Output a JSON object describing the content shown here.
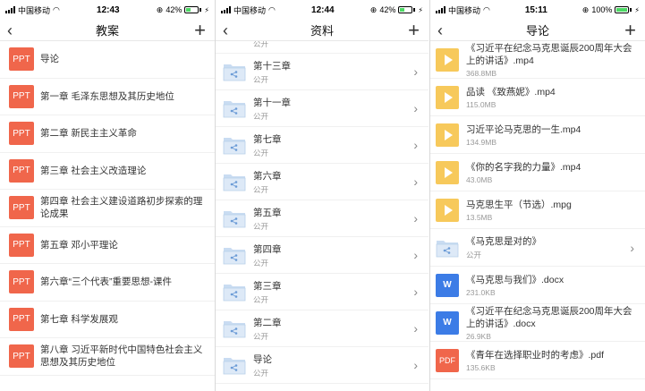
{
  "panel1": {
    "status": {
      "carrier": "中国移动",
      "time": "12:43",
      "battery": "42%"
    },
    "title": "教案",
    "items": [
      {
        "badge": "PPT",
        "label": "导论"
      },
      {
        "badge": "PPT",
        "label": "第一章 毛泽东思想及其历史地位"
      },
      {
        "badge": "PPT",
        "label": "第二章 新民主主义革命"
      },
      {
        "badge": "PPT",
        "label": "第三章 社会主义改造理论"
      },
      {
        "badge": "PPT",
        "label": "第四章 社会主义建设道路初步探索的理论成果"
      },
      {
        "badge": "PPT",
        "label": "第五章 邓小平理论"
      },
      {
        "badge": "PPT",
        "label": "第六章“三个代表”重要思想-课件"
      },
      {
        "badge": "PPT",
        "label": "第七章 科学发展观"
      },
      {
        "badge": "PPT",
        "label": "第八章 习近平新时代中国特色社会主义思想及其历史地位"
      }
    ]
  },
  "panel2": {
    "status": {
      "carrier": "中国移动",
      "time": "12:44",
      "battery": "42%"
    },
    "title": "资料",
    "top_partial": "公开",
    "items": [
      {
        "name": "第十三章",
        "sub": "公开"
      },
      {
        "name": "第十一章",
        "sub": "公开"
      },
      {
        "name": "第七章",
        "sub": "公开"
      },
      {
        "name": "第六章",
        "sub": "公开"
      },
      {
        "name": "第五章",
        "sub": "公开"
      },
      {
        "name": "第四章",
        "sub": "公开"
      },
      {
        "name": "第三章",
        "sub": "公开"
      },
      {
        "name": "第二章",
        "sub": "公开"
      },
      {
        "name": "导论",
        "sub": "公开"
      }
    ]
  },
  "panel3": {
    "status": {
      "carrier": "中国移动",
      "time": "15:11",
      "battery": "100%"
    },
    "title": "导论",
    "items": [
      {
        "type": "video",
        "name": "《习近平在纪念马克思诞辰200周年大会上的讲话》.mp4",
        "sub": "368.8MB"
      },
      {
        "type": "video",
        "name": "品读 《致燕妮》.mp4",
        "sub": "115.0MB"
      },
      {
        "type": "video",
        "name": "习近平论马克思的一生.mp4",
        "sub": "134.9MB"
      },
      {
        "type": "video",
        "name": "《你的名字我的力量》.mp4",
        "sub": "43.0MB"
      },
      {
        "type": "video",
        "name": "马克思生平（节选）.mpg",
        "sub": "13.5MB"
      },
      {
        "type": "folder",
        "name": "《马克思是对的》",
        "sub": "公开"
      },
      {
        "type": "word",
        "name": "《马克思与我们》.docx",
        "sub": "231.0KB"
      },
      {
        "type": "word",
        "name": "《习近平在纪念马克思诞辰200周年大会上的讲话》.docx",
        "sub": "26.9KB"
      },
      {
        "type": "pdf",
        "name": "《青年在选择职业时的考虑》.pdf",
        "sub": "135.6KB"
      }
    ],
    "badges": {
      "word": "W",
      "pdf": "PDF"
    }
  },
  "colors": {
    "ppt_badge": "#f0664b",
    "video_icon": "#f7c95b",
    "word_icon": "#3c7ce6",
    "folder": "#c9dcf2",
    "battery_fill": "#4cd964"
  }
}
